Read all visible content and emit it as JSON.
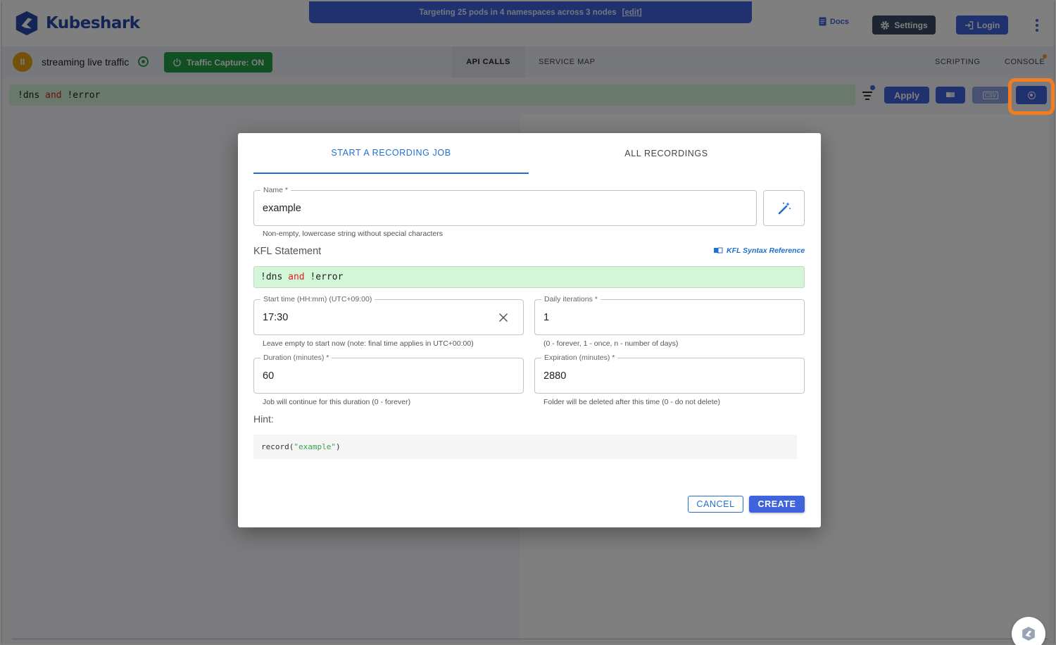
{
  "app": {
    "name": "Kubeshark"
  },
  "banner": {
    "text": "Targeting 25 pods in 4 namespaces across 3 nodes",
    "edit_label": "[edit]"
  },
  "header": {
    "docs_label": "Docs",
    "settings_label": "Settings",
    "login_label": "Login"
  },
  "toolbar": {
    "pause_icon": "II",
    "status_label": "streaming live traffic",
    "capture_label": "Traffic Capture: ON",
    "tabs": [
      "API CALLS",
      "SERVICE MAP",
      "SCRIPTING",
      "CONSOLE"
    ],
    "active_tab": "API CALLS"
  },
  "filter": {
    "query_prefix": "!dns ",
    "query_keyword": "and",
    "query_suffix": " !error",
    "apply_label": "Apply",
    "csv_label": "CSV"
  },
  "modal": {
    "tabs": [
      "START A RECORDING JOB",
      "ALL RECORDINGS"
    ],
    "active_tab": "START A RECORDING JOB",
    "name": {
      "label": "Name *",
      "value": "example",
      "helper": "Non-empty, lowercase string without special characters"
    },
    "kfl": {
      "title": "KFL Statement",
      "reference_label": "KFL Syntax Reference",
      "prefix": "!dns ",
      "keyword": "and",
      "suffix": " !error"
    },
    "start_time": {
      "label": "Start time (HH:mm) (UTC+09:00)",
      "value": "17:30",
      "helper": "Leave empty to start now (note: final time applies in UTC+00:00)"
    },
    "daily_iterations": {
      "label": "Daily iterations *",
      "value": "1",
      "helper": "(0 - forever, 1 - once, n - number of days)"
    },
    "duration": {
      "label": "Duration (minutes) *",
      "value": "60",
      "helper": "Job will continue for this duration (0 - forever)"
    },
    "expiration": {
      "label": "Expiration (minutes) *",
      "value": "2880",
      "helper": "Folder will be deleted after this time (0 - do not delete)"
    },
    "hint": {
      "title": "Hint:",
      "code_prefix": "record(",
      "code_string": "\"example\"",
      "code_suffix": ")"
    },
    "cancel_label": "CANCEL",
    "create_label": "CREATE"
  },
  "colors": {
    "brand": "#2849a8",
    "accent": "#3e63dd",
    "success": "#21a146",
    "warning": "#e8a317",
    "highlight": "#f47c20",
    "query_background": "#d3f5d8"
  },
  "icons": [
    "kubeshark-logo-icon",
    "docs-icon",
    "gear-icon",
    "login-icon",
    "more-vertical-icon",
    "pause-icon",
    "power-icon",
    "filter-icon",
    "book-icon",
    "csv-icon",
    "record-icon",
    "magic-wand-icon",
    "close-icon"
  ]
}
